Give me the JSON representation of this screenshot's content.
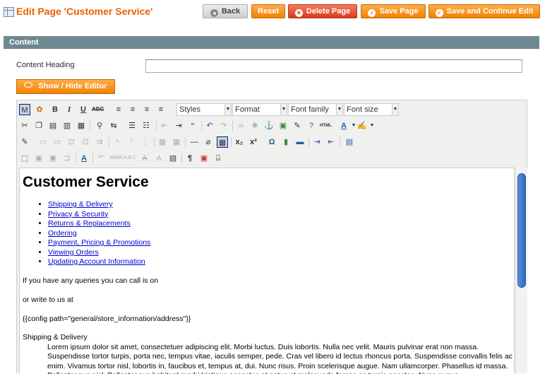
{
  "header": {
    "title": "Edit Page 'Customer Service'"
  },
  "buttons": {
    "back": "Back",
    "reset": "Reset",
    "delete": "Delete Page",
    "save": "Save Page",
    "save_continue": "Save and Continue Edit"
  },
  "section": {
    "title": "Content"
  },
  "form": {
    "content_heading_label": "Content Heading",
    "content_heading_value": "",
    "show_hide_editor": "Show / Hide Editor"
  },
  "toolbar": {
    "styles": "Styles",
    "format": "Format",
    "font_family": "Font family",
    "font_size": "Font size"
  },
  "editor": {
    "heading": "Customer Service",
    "links": [
      "Shipping & Delivery",
      "Privacy & Security",
      "Returns & Replacements",
      "Ordering",
      "Payment, Pricing & Promotions",
      "Viewing Orders",
      "Updating Account Information"
    ],
    "p1": "If you have any queries you can call is on",
    "p2": "or write to us at",
    "p3": "{{config path=\"general/store_information/address\"}}",
    "p4": "Shipping & Delivery",
    "lorem": "Lorem ipsum dolor sit amet, consectetuer adipiscing elit. Morbi luctus. Duis lobortis. Nulla nec velit. Mauris pulvinar erat non massa. Suspendisse tortor turpis, porta nec, tempus vitae, iaculis semper, pede. Cras vel libero id lectus rhoncus porta. Suspendisse convallis felis ac enim. Vivamus tortor nisl, lobortis in, faucibus et, tempus at, dui. Nunc risus. Proin scelerisque augue. Nam ullamcorper. Phasellus id massa. Pellentesque nisl. Pellentesque habitant morbi tristique senectus et netus et malesuada fames ac turpis egestas. Nunc augue."
  }
}
